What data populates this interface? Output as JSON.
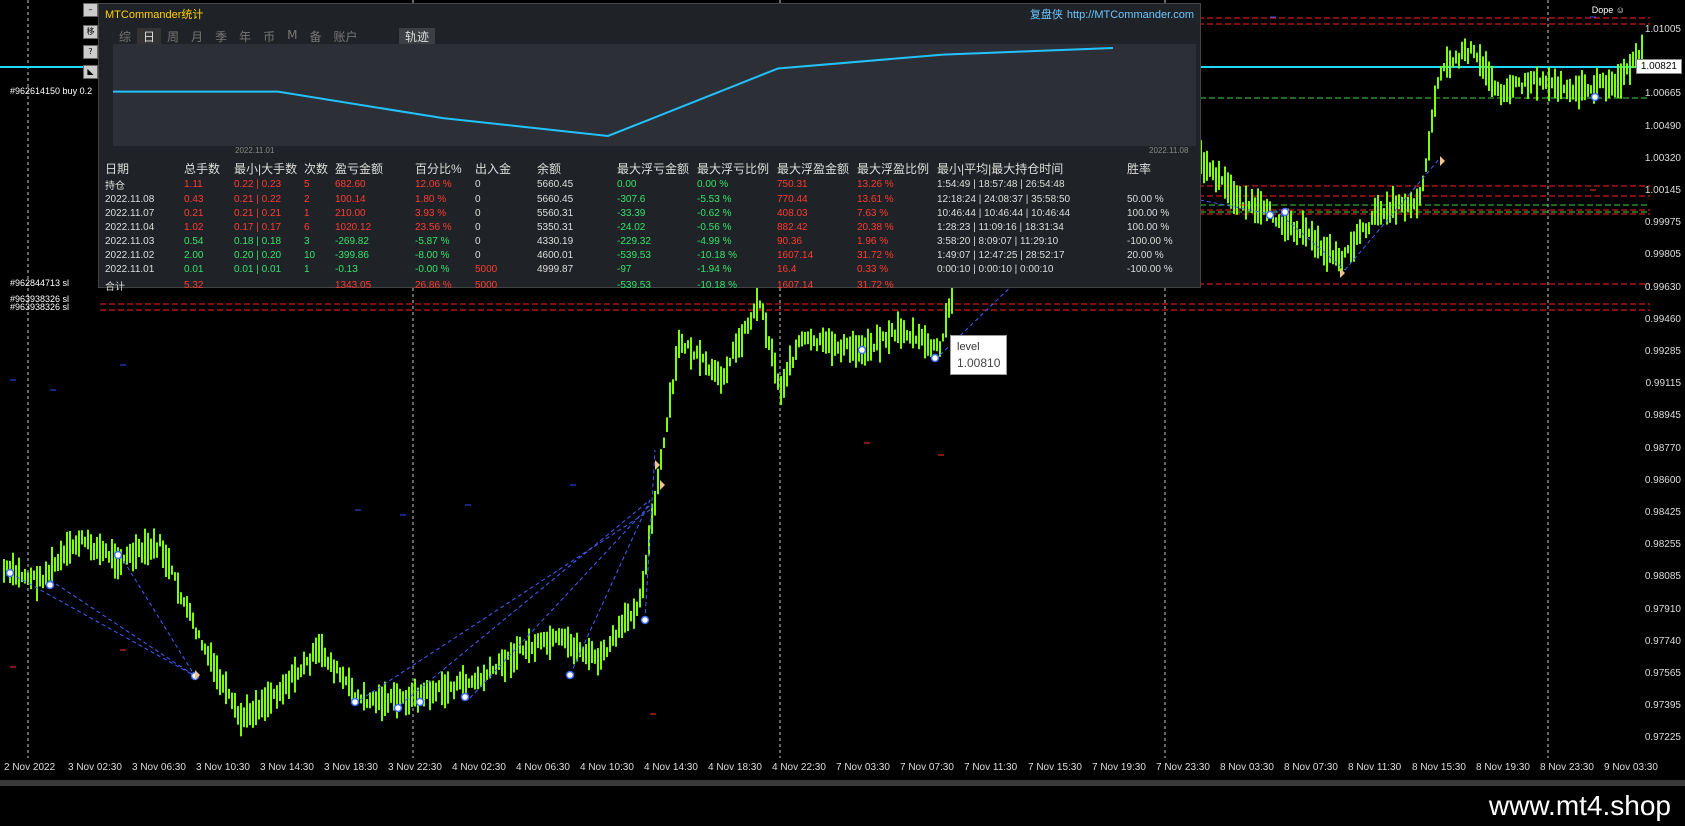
{
  "panel": {
    "title": "MTCommander统计",
    "brand_cn": "复盘侠",
    "brand_url": "http://MTCommander.com",
    "tabs": [
      "综",
      "日",
      "周",
      "月",
      "季",
      "年",
      "币",
      "M",
      "备",
      "账户"
    ],
    "active_tab": "日",
    "track_tab": "轨迹",
    "chart_start_date": "2022.11.01",
    "chart_end_date": "2022.11.08",
    "headers": [
      "日期",
      "总手数",
      "最小|大手数",
      "次数",
      "盈亏金额",
      "百分比%",
      "出入金",
      "余额",
      "最大浮亏金额",
      "最大浮亏比例",
      "最大浮盈金额",
      "最大浮盈比例",
      "最小|平均|最大持仓时间",
      "胜率"
    ],
    "rows": [
      {
        "date": "持仓",
        "lots": "1.11",
        "minmax": "0.22 | 0.23",
        "count": "5",
        "pnl": "682.60",
        "pct": "12.06 %",
        "io": "0",
        "balance": "5660.45",
        "mfl": "0.00",
        "mflp": "0.00 %",
        "mfp": "750.31",
        "mfpp": "13.26 %",
        "time": "1:54:49 | 18:57:48 | 26:54:48",
        "win": ""
      },
      {
        "date": "2022.11.08",
        "lots": "0.43",
        "minmax": "0.21 | 0.22",
        "count": "2",
        "pnl": "100.14",
        "pct": "1.80 %",
        "io": "0",
        "balance": "5660.45",
        "mfl": "-307.6",
        "mflp": "-5.53 %",
        "mfp": "770.44",
        "mfpp": "13.61 %",
        "time": "12:18:24 | 24:08:37 | 35:58:50",
        "win": "50.00 %"
      },
      {
        "date": "2022.11.07",
        "lots": "0.21",
        "minmax": "0.21 | 0.21",
        "count": "1",
        "pnl": "210.00",
        "pct": "3.93 %",
        "io": "0",
        "balance": "5560.31",
        "mfl": "-33.39",
        "mflp": "-0.62 %",
        "mfp": "408.03",
        "mfpp": "7.63 %",
        "time": "10:46:44 | 10:46:44 | 10:46:44",
        "win": "100.00 %"
      },
      {
        "date": "2022.11.04",
        "lots": "1.02",
        "minmax": "0.17 | 0.17",
        "count": "6",
        "pnl": "1020.12",
        "pct": "23.56 %",
        "io": "0",
        "balance": "5350.31",
        "mfl": "-24.02",
        "mflp": "-0.56 %",
        "mfp": "882.42",
        "mfpp": "20.38 %",
        "time": "1:28:23 | 11:09:16 | 18:31:34",
        "win": "100.00 %"
      },
      {
        "date": "2022.11.03",
        "lots": "0.54",
        "minmax": "0.18 | 0.18",
        "count": "3",
        "pnl": "-269.82",
        "pct": "-5.87 %",
        "io": "0",
        "balance": "4330.19",
        "mfl": "-229.32",
        "mflp": "-4.99 %",
        "mfp": "90.36",
        "mfpp": "1.96 %",
        "time": "3:58:20 | 8:09:07 | 11:29:10",
        "win": "-100.00 %"
      },
      {
        "date": "2022.11.02",
        "lots": "2.00",
        "minmax": "0.20 | 0.20",
        "count": "10",
        "pnl": "-399.86",
        "pct": "-8.00 %",
        "io": "0",
        "balance": "4600.01",
        "mfl": "-539.53",
        "mflp": "-10.18 %",
        "mfp": "1607.14",
        "mfpp": "31.72 %",
        "time": "1:49:07 | 12:47:25 | 28:52:17",
        "win": "20.00 %"
      },
      {
        "date": "2022.11.01",
        "lots": "0.01",
        "minmax": "0.01 | 0.01",
        "count": "1",
        "pnl": "-0.13",
        "pct": "-0.00 %",
        "io": "5000",
        "balance": "4999.87",
        "mfl": "-97",
        "mflp": "-1.94 %",
        "mfp": "16.4",
        "mfpp": "0.33 %",
        "time": "0:00:10 | 0:00:10 | 0:00:10",
        "win": "-100.00 %"
      }
    ],
    "total": {
      "date": "合计",
      "lots": "5.32",
      "minmax": "",
      "count": "",
      "pnl": "1343.05",
      "pct": "26.86 %",
      "io": "5000",
      "balance": "",
      "mfl": "-539.53",
      "mflp": "-10.18 %",
      "mfp": "1607.14",
      "mfpp": "31.72 %",
      "time": "",
      "win": ""
    },
    "equity_curve": [
      5000,
      4999.87,
      4600.01,
      4330.19,
      5350.31,
      5560.31,
      5660.45
    ]
  },
  "chart": {
    "price_labels": [
      "1.01005",
      "1.00821",
      "1.00665",
      "1.00490",
      "1.00320",
      "1.00145",
      "0.99975",
      "0.99805",
      "0.99630",
      "0.99460",
      "0.99285",
      "0.99115",
      "0.98945",
      "0.98770",
      "0.98600",
      "0.98425",
      "0.98255",
      "0.98085",
      "0.97910",
      "0.97740",
      "0.97565",
      "0.97395",
      "0.97225"
    ],
    "current_price": "1.00821",
    "time_labels": [
      "2 Nov 2022",
      "3 Nov 02:30",
      "3 Nov 06:30",
      "3 Nov 10:30",
      "3 Nov 14:30",
      "3 Nov 18:30",
      "3 Nov 22:30",
      "4 Nov 02:30",
      "4 Nov 06:30",
      "4 Nov 10:30",
      "4 Nov 14:30",
      "4 Nov 18:30",
      "4 Nov 22:30",
      "7 Nov 03:30",
      "7 Nov 07:30",
      "7 Nov 11:30",
      "7 Nov 15:30",
      "7 Nov 19:30",
      "7 Nov 23:30",
      "8 Nov 03:30",
      "8 Nov 07:30",
      "8 Nov 11:30",
      "8 Nov 15:30",
      "8 Nov 19:30",
      "8 Nov 23:30",
      "9 Nov 03:30"
    ],
    "order_labels": [
      "#962614150 buy 0.2",
      "#962844713 sl",
      "#963938326 sl",
      "#963938326 sl"
    ],
    "tooltip_title": "level",
    "tooltip_value": "1.00810",
    "dope_label": "Dope"
  },
  "footer": {
    "brand": "www.mt4.shop"
  },
  "colors": {
    "candle": "#7cff00",
    "equity_line": "#22c2ff",
    "level_line": "#22d8ff",
    "stop_line": "#ff2020",
    "trade_line": "#4060ff"
  }
}
